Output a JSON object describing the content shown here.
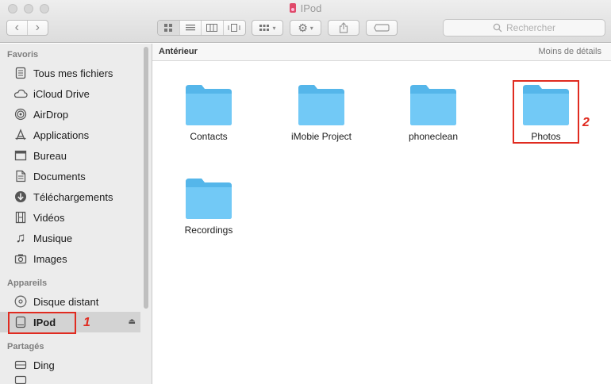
{
  "window": {
    "title": "IPod"
  },
  "toolbar": {
    "back_label": "‹",
    "forward_label": "›",
    "search_placeholder": "Rechercher"
  },
  "sidebar": {
    "sections": {
      "favorites": "Favoris",
      "devices": "Appareils",
      "shared": "Partagés"
    },
    "favorites": [
      {
        "label": "Tous mes fichiers",
        "icon": "all-files-icon"
      },
      {
        "label": "iCloud Drive",
        "icon": "cloud-icon"
      },
      {
        "label": "AirDrop",
        "icon": "airdrop-icon"
      },
      {
        "label": "Applications",
        "icon": "applications-icon"
      },
      {
        "label": "Bureau",
        "icon": "desktop-icon"
      },
      {
        "label": "Documents",
        "icon": "document-icon"
      },
      {
        "label": "Téléchargements",
        "icon": "download-icon"
      },
      {
        "label": "Vidéos",
        "icon": "film-icon"
      },
      {
        "label": "Musique",
        "icon": "music-icon"
      },
      {
        "label": "Images",
        "icon": "camera-icon"
      }
    ],
    "devices": [
      {
        "label": "Disque distant",
        "icon": "disc-icon"
      },
      {
        "label": "IPod",
        "icon": "drive-icon",
        "selected": true
      }
    ],
    "shared": [
      {
        "label": "Ding",
        "icon": "server-icon"
      }
    ]
  },
  "pathbar": {
    "left": "Antérieur",
    "right": "Moins de détails"
  },
  "folders": [
    "Contacts",
    "iMobie Project",
    "phoneclean",
    "Photos",
    "Recordings"
  ],
  "annotations": {
    "callout_1": "1",
    "callout_2": "2"
  },
  "colors": {
    "accent_red": "#e02b20",
    "folder_blue": "#6cc6f5"
  }
}
